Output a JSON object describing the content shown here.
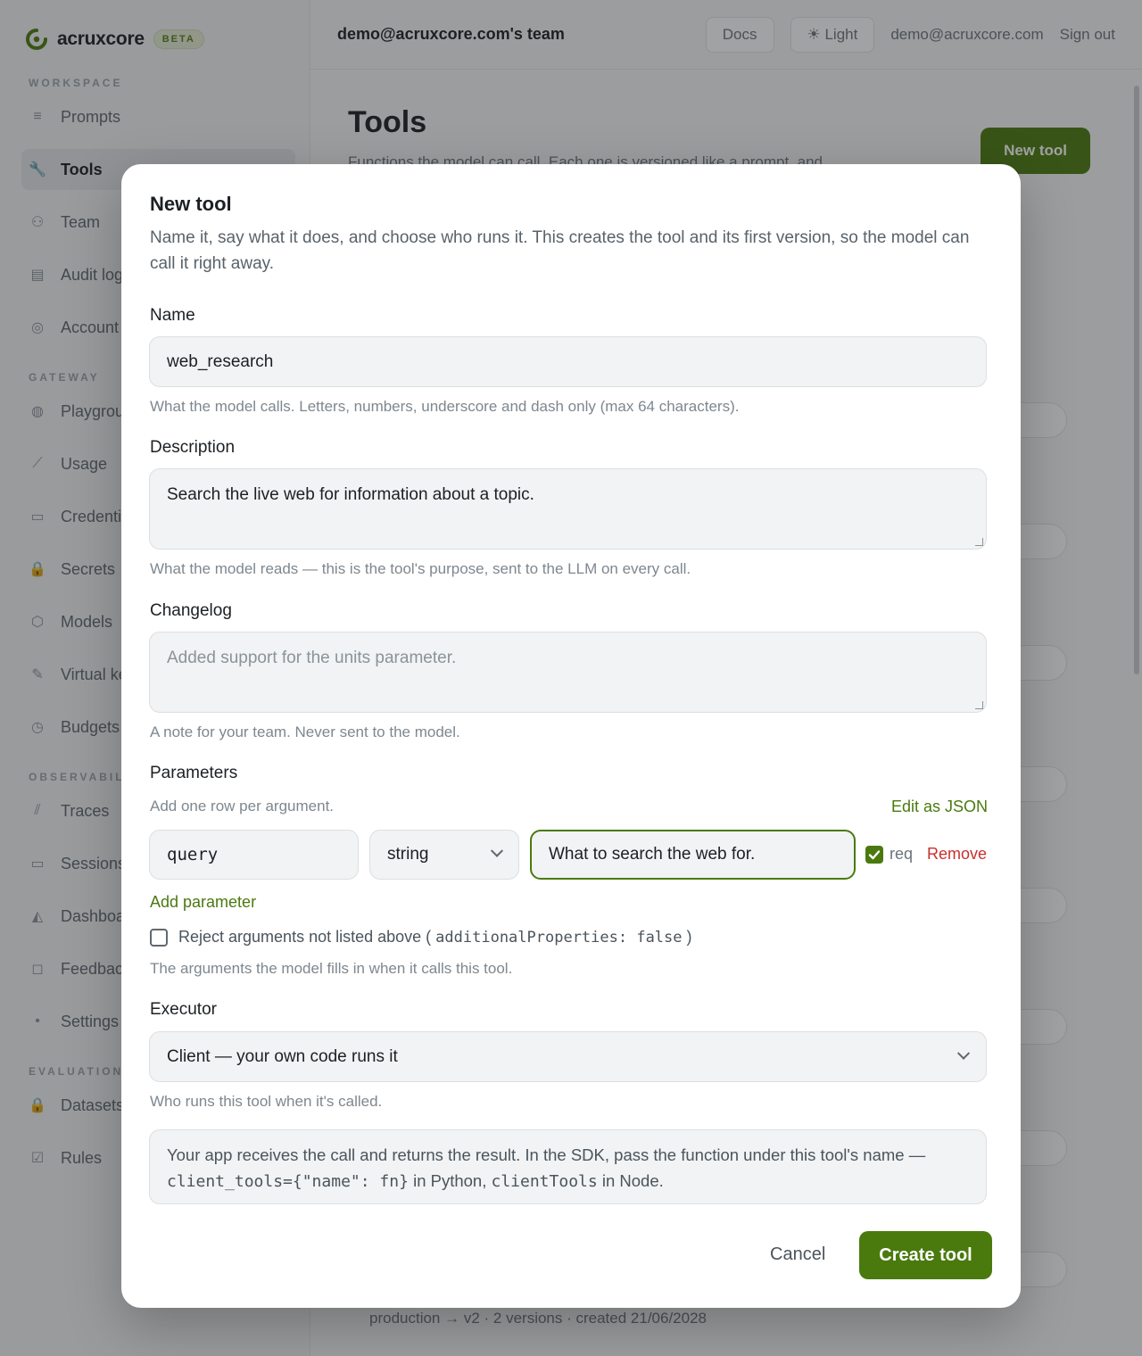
{
  "app": {
    "brand": "acruxcore",
    "beta": "BETA",
    "team": "demo@acruxcore.com's team",
    "docs": "Docs",
    "theme": "Light",
    "user_email": "demo@acruxcore.com",
    "sign_out": "Sign out",
    "page_title": "Tools",
    "page_subtitle": "Functions the model can call. Each one is versioned like a prompt, and",
    "new_tool": "New tool",
    "footer_meta": "production → v2 · 2 versions · created 21/06/2028"
  },
  "sidebar": {
    "sections": [
      {
        "title": "WORKSPACE",
        "items": [
          {
            "label": "Prompts",
            "icon": "prompts-icon",
            "glyph": "≡"
          },
          {
            "label": "Tools",
            "icon": "wrench-icon",
            "glyph": "🔧",
            "active": true
          },
          {
            "label": "Team",
            "icon": "team-icon",
            "glyph": "⚇"
          },
          {
            "label": "Audit log",
            "icon": "document-icon",
            "glyph": "▤"
          },
          {
            "label": "Account",
            "icon": "account-icon",
            "glyph": "◎"
          }
        ]
      },
      {
        "title": "GATEWAY",
        "items": [
          {
            "label": "Playground",
            "icon": "playground-icon",
            "glyph": "◍"
          },
          {
            "label": "Usage",
            "icon": "chart-icon",
            "glyph": "⟋"
          },
          {
            "label": "Credentials",
            "icon": "credentials-icon",
            "glyph": "▭"
          },
          {
            "label": "Secrets",
            "icon": "lock-icon",
            "glyph": "🔒"
          },
          {
            "label": "Models",
            "icon": "models-icon",
            "glyph": "⬡"
          },
          {
            "label": "Virtual keys",
            "icon": "key-icon",
            "glyph": "✎"
          },
          {
            "label": "Budgets",
            "icon": "clock-icon",
            "glyph": "◷"
          }
        ]
      },
      {
        "title": "OBSERVABILITY",
        "items": [
          {
            "label": "Traces",
            "icon": "traces-icon",
            "glyph": "⫽"
          },
          {
            "label": "Sessions",
            "icon": "sessions-icon",
            "glyph": "▭"
          },
          {
            "label": "Dashboards",
            "icon": "dashboard-icon",
            "glyph": "◭"
          },
          {
            "label": "Feedback",
            "icon": "feedback-icon",
            "glyph": "◻"
          },
          {
            "label": "Settings",
            "icon": "settings-icon",
            "glyph": "•"
          }
        ]
      },
      {
        "title": "EVALUATION",
        "items": [
          {
            "label": "Datasets",
            "icon": "datasets-icon",
            "glyph": "🔒"
          },
          {
            "label": "Rules",
            "icon": "rules-icon",
            "glyph": "☑"
          }
        ]
      }
    ]
  },
  "modal": {
    "title": "New tool",
    "subtitle": "Name it, say what it does, and choose who runs it. This creates the tool and its first version, so the model can call it right away.",
    "name": {
      "label": "Name",
      "value": "web_research",
      "hint": "What the model calls. Letters, numbers, underscore and dash only (max 64 characters)."
    },
    "description": {
      "label": "Description",
      "value": "Search the live web for information about a topic.",
      "hint": "What the model reads — this is the tool's purpose, sent to the LLM on every call."
    },
    "changelog": {
      "label": "Changelog",
      "placeholder": "Added support for the units parameter.",
      "hint": "A note for your team. Never sent to the model."
    },
    "parameters": {
      "label": "Parameters",
      "hint": "Add one row per argument.",
      "edit_json": "Edit as JSON",
      "rows": [
        {
          "name": "query",
          "type": "string",
          "description": "What to search the web for.",
          "required": true,
          "req_label": "req",
          "remove_label": "Remove"
        }
      ],
      "add_label": "Add parameter",
      "reject_label": "Reject arguments not listed above (",
      "reject_code": "additionalProperties: false",
      "reject_close": ")",
      "reject_checked": false,
      "footer_hint": "The arguments the model fills in when it calls this tool."
    },
    "executor": {
      "label": "Executor",
      "value": "Client — your own code runs it",
      "hint": "Who runs this tool when it's called.",
      "note_part1": "Your app receives the call and returns the result. In the SDK, pass the function under this tool's name —",
      "note_code1": "client_tools={\"name\": fn}",
      "note_part2": "in Python,",
      "note_code2": "clientTools",
      "note_part3": "in Node."
    },
    "cancel": "Cancel",
    "submit": "Create tool"
  },
  "colors": {
    "accent": "#4a7a0e",
    "danger": "#c9302c"
  }
}
